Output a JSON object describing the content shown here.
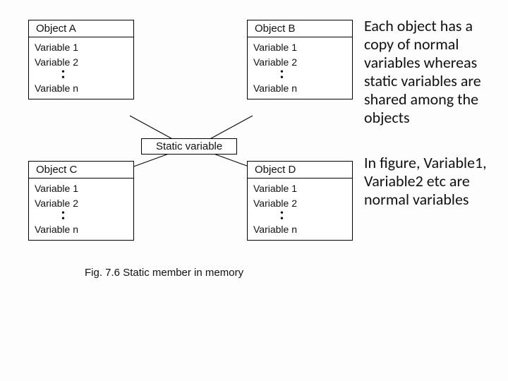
{
  "diagram": {
    "objects": {
      "a": {
        "title": "Object A",
        "v1": "Variable 1",
        "v2": "Variable 2",
        "vn": "Variable n"
      },
      "b": {
        "title": "Object B",
        "v1": "Variable 1",
        "v2": "Variable 2",
        "vn": "Variable n"
      },
      "c": {
        "title": "Object C",
        "v1": "Variable 1",
        "v2": "Variable 2",
        "vn": "Variable n"
      },
      "d": {
        "title": "Object D",
        "v1": "Variable 1",
        "v2": "Variable 2",
        "vn": "Variable n"
      }
    },
    "static_label": "Static variable",
    "caption": "Fig. 7.6 Static member in memory"
  },
  "text": {
    "para1": "Each object has a copy of normal variables whereas static variables are shared among the objects",
    "para2": "In figure, Variable1, Variable2 etc are normal variables"
  }
}
